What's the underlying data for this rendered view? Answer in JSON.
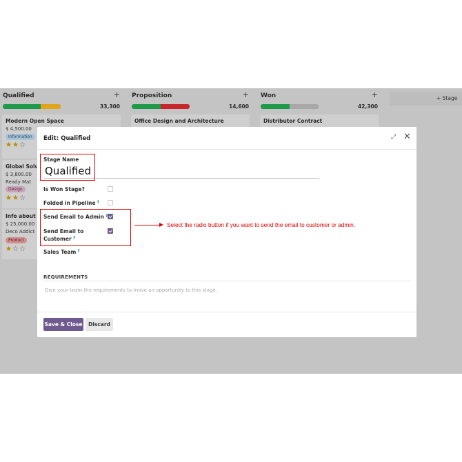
{
  "kanban": {
    "columns": [
      {
        "title": "Qualified",
        "total": "33,300",
        "progress": [
          {
            "color": "#1e9b4a",
            "fraction": 0.65
          },
          {
            "color": "#e2a41b",
            "fraction": 0.35
          }
        ],
        "cards": [
          {
            "title": "Modern Open Space",
            "amount": "$ 4,500.00",
            "tag": "Information",
            "tag_bg": "#a9c3d6",
            "stars": 2
          },
          {
            "title": "Global Solu",
            "amount": "$ 3,800.00",
            "company": "Ready Mat",
            "tag": "Design",
            "tag_bg": "#c9a3b9",
            "stars": 2
          },
          {
            "title": "Info about",
            "amount": "$ 25,000.00",
            "company": "Deco Addict",
            "tag": "Product",
            "tag_bg": "#d18f8f",
            "stars": 1
          }
        ]
      },
      {
        "title": "Proposition",
        "total": "14,600",
        "progress": [
          {
            "color": "#1e9b4a",
            "fraction": 0.5
          },
          {
            "color": "#c9252f",
            "fraction": 0.5
          }
        ],
        "cards": [
          {
            "title": "Office Design and Architecture"
          }
        ]
      },
      {
        "title": "Won",
        "total": "42,300",
        "progress": [
          {
            "color": "#1e9b4a",
            "fraction": 0.5
          },
          {
            "color": "#a8a8a8",
            "fraction": 0.5
          }
        ],
        "cards": [
          {
            "title": "Distributor Contract"
          }
        ]
      }
    ],
    "plus": "+",
    "add_stage": "+  Stage"
  },
  "dialog": {
    "title": "Edit: Qualified",
    "expand_icon": "expand-icon",
    "close_icon": "close-icon",
    "stage_name_label": "Stage Name",
    "stage_name_value": "Qualified",
    "fields": {
      "is_won": {
        "label": "Is Won Stage?",
        "checked": false
      },
      "folded": {
        "label": "Folded in Pipeline",
        "help": "?",
        "checked": false
      },
      "send_admin": {
        "label": "Send Email to Admin",
        "help": "?",
        "checked": true
      },
      "send_customer": {
        "label_line1": "Send Email to",
        "label_line2": "Customer",
        "help": "?",
        "checked": true
      },
      "sales_team": {
        "label": "Sales Team",
        "help": "?"
      }
    },
    "requirements_title": "REQUIREMENTS",
    "requirements_placeholder": "Give your team the requirements to move an opportunity to this stage.",
    "save_button": "Save & Close",
    "discard_button": "Discard"
  },
  "annotation": {
    "note": "Select the radio button if you want to send the email to customer or admin.",
    "color": "#e00000"
  },
  "colors": {
    "accent": "#6f5a8f",
    "overlay": "#c4c4c4"
  }
}
